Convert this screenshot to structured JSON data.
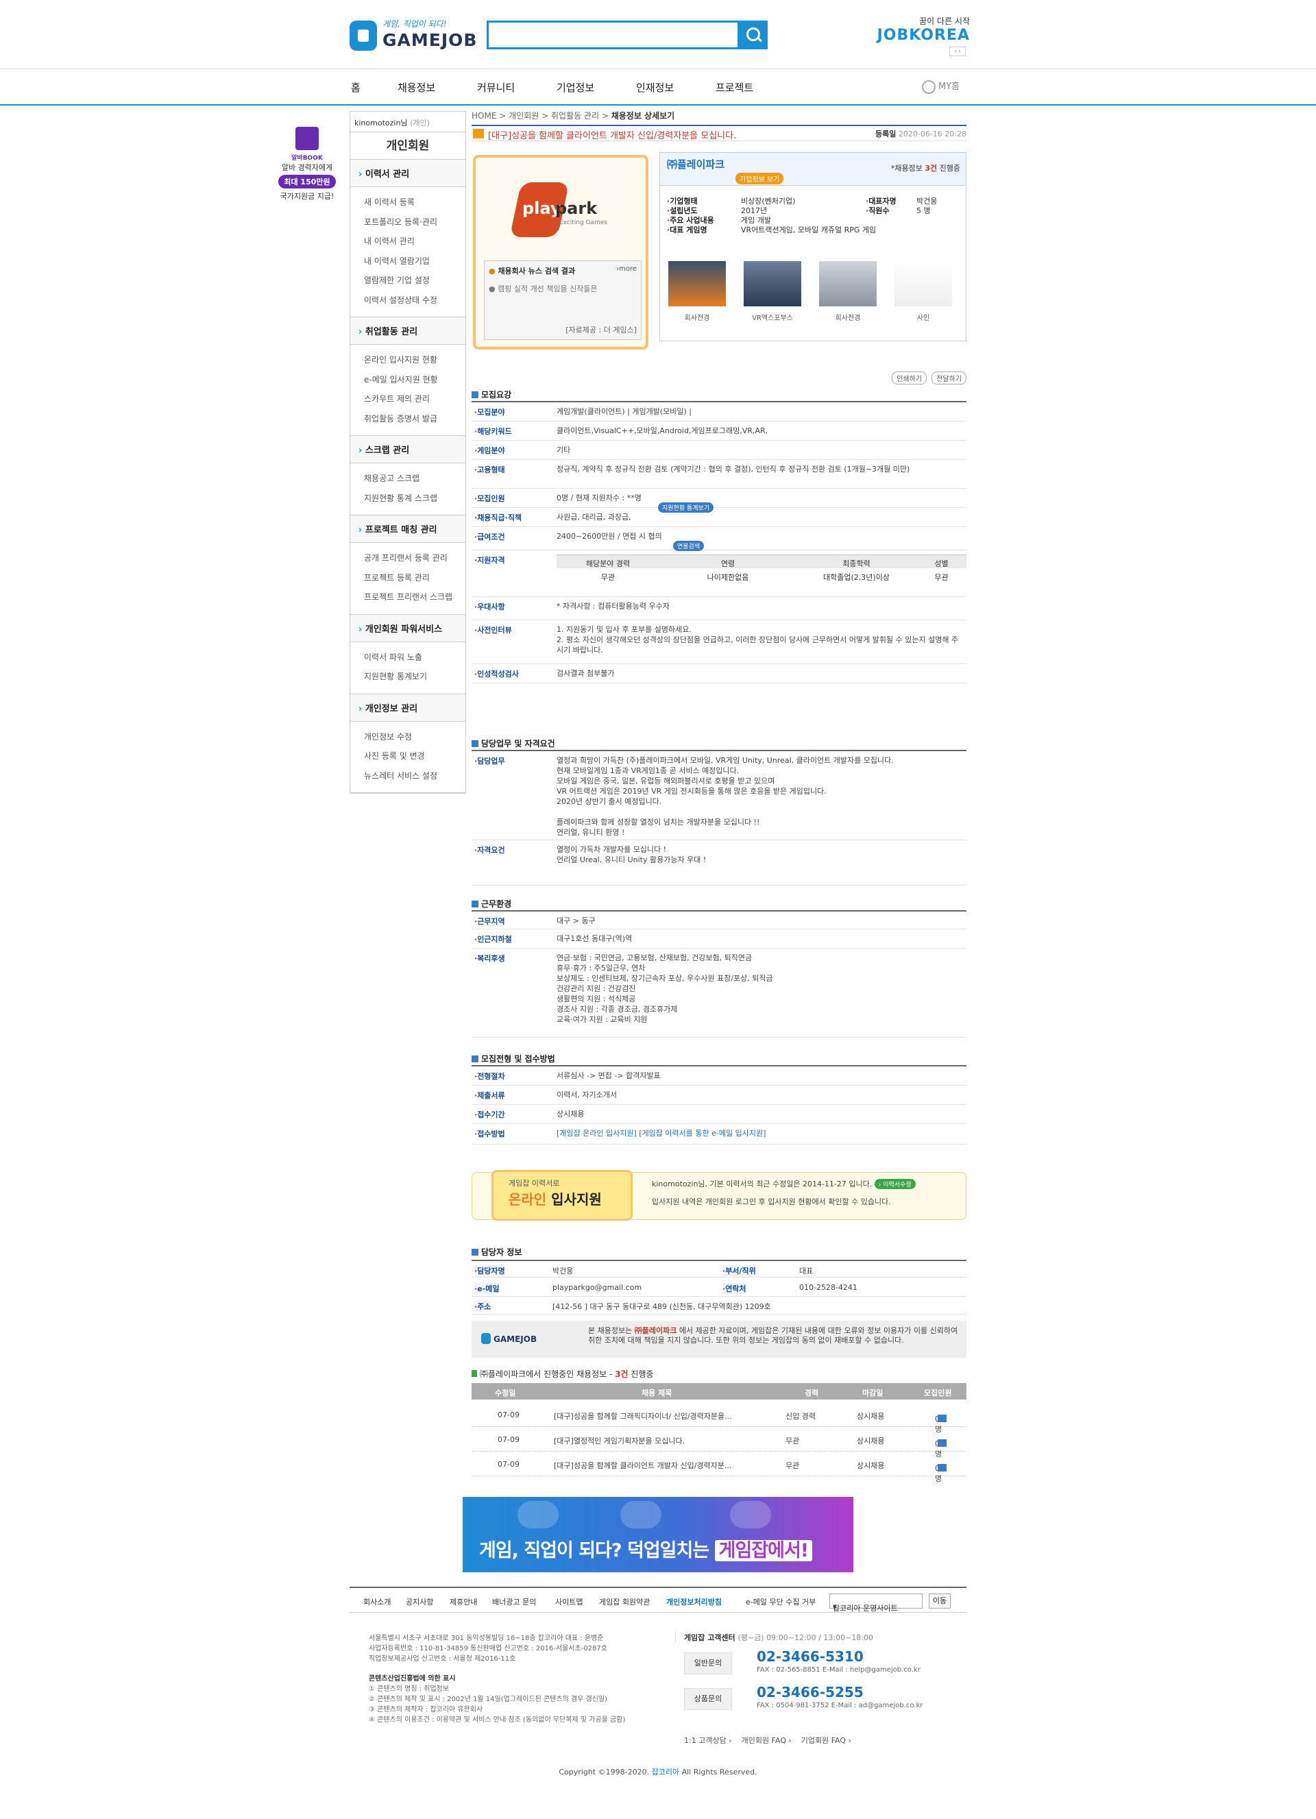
{
  "header": {
    "logo_tag": "게임, 직업이 되다!",
    "logo_name": "GAMEJOB",
    "search_value": "",
    "jobkorea_small": "꿈이 다른 시작",
    "jobkorea_big": "JOBKOREA",
    "jk_arrows": "‹ ›"
  },
  "gnb": [
    "홈",
    "채용정보",
    "커뮤니티",
    "기업정보",
    "인재정보",
    "프로젝트"
  ],
  "myhome": "MY홈",
  "sidebanner": {
    "brand": "알바BOOK",
    "l1": "알바 경력자에게",
    "pill": "최대 150만원",
    "l2": "국가지원금 지급!"
  },
  "lnb": {
    "user": "kinomotozin님",
    "user_type": "(개인)",
    "title": "개인회원",
    "sections": [
      {
        "name": "이력서 관리",
        "items": [
          "새 이력서 등록",
          "포트폴리오 등록·관리",
          "내 이력서 관리",
          "내 이력서 열람기업",
          "열람제한 기업 설정",
          "이력서 설정상태 수정"
        ]
      },
      {
        "name": "취업활동 관리",
        "items": [
          "온라인 입사지원 현황",
          "e-메일 입사지원 현황",
          "스카우트 제의 관리",
          "취업활동 증명서 발급"
        ]
      },
      {
        "name": "스크랩 관리",
        "items": [
          "채용공고 스크랩",
          "지원현황 통계 스크랩"
        ]
      },
      {
        "name": "프로젝트 매칭 관리",
        "items": [
          "공개 프리랜서 등록 관리",
          "프로젝트 등록 관리",
          "프로젝트 프리랜서 스크랩"
        ]
      },
      {
        "name": "개인회원 파워서비스",
        "items": [
          "이력서 파워 노출",
          "지원현황 통계보기"
        ]
      },
      {
        "name": "개인정보 관리",
        "items": [
          "개인정보 수정",
          "사진 등록 및 변경",
          "뉴스레터 서비스 설정"
        ]
      }
    ]
  },
  "breadcrumb": {
    "a": "HOME",
    "b": "개인회원",
    "c": "취업활동 관리",
    "d": "채용정보 상세보기"
  },
  "job": {
    "title": "[대구]성공을 함께할 클라이언트 개발자 신입/경력자분을 모십니다.",
    "reg_label": "등록일",
    "reg_date": "2020-06-16 20:28"
  },
  "company": {
    "card_logo1": "play",
    "card_logo2": "park",
    "card_logo3": "Exciting Games",
    "news_head": "채용회사 뉴스 검색 결과",
    "news_more": "›more",
    "news_item": "● 캠핑 실적 개선 책임을 신작들은",
    "news_src": "[자료제공 : 더 게임스]",
    "name": "㈜플레이파크",
    "info_btn": "기업정보 보기",
    "count_pre": "*채용정보",
    "count_num": "3건",
    "count_post": "진행중",
    "rows": [
      [
        "기업형태",
        "비상장(벤처기업)"
      ],
      [
        "설립년도",
        "2017년"
      ],
      [
        "주요 사업내용",
        "게임 개발"
      ],
      [
        "대표 게임명",
        "VR어트랙션게임, 모바일 캐쥬얼 RPG 게임"
      ]
    ],
    "rows2": [
      [
        "대표자명",
        "박건웅"
      ],
      [
        "직원수",
        "5 명"
      ]
    ],
    "thumbs": [
      "회사전경",
      "VR엑스포부스",
      "회사전경",
      "사인"
    ]
  },
  "print_btns": [
    "인쇄하기",
    "전달하기"
  ],
  "recruit": {
    "header": "모집요강",
    "rows": [
      {
        "k": "모집분야",
        "v": "게임개발(클라이언트) | 게임개발(모바일) |"
      },
      {
        "k": "해당키워드",
        "v": "클라이언트,VisualC++,모바일,Android,게임프로그래밍,VR,AR,"
      },
      {
        "k": "게임분야",
        "v": "기타"
      },
      {
        "k": "고용형태",
        "v": "정규직, 계약직 후 정규직 전환 검토 (계약기간 : 협의 후 결정), 인턴직 후 정규직 전환 검토 (1개월~3개월 미만)"
      },
      {
        "k": "모집인원",
        "v": "0명 / 현재 지원자수 : **명"
      },
      {
        "k": "채용직급·직책",
        "v": "사원급, 대리급, 과장급,"
      },
      {
        "k": "급여조건",
        "v": "2400~2600만원 / 면접 시 협의"
      },
      {
        "k": "지원자격",
        "v": ""
      },
      {
        "k": "우대사항",
        "v": "* 자격사항 : 컴퓨터활용능력 우수자"
      },
      {
        "k": "사전인터뷰",
        "v": "1. 지원동기 및 입사 후 포부를 설명하세요.\n2. 평소 자신이 생각해오던 성격상의 장단점을 언급하고, 이러한 장단점이 당사에 근무하면서 어떻게 발휘될 수 있는지 설명해 주시기 바랍니다."
      },
      {
        "k": "인성적성검사",
        "v": "검사결과 첨부불가"
      }
    ],
    "badge_stats": "지원현황 통계보기",
    "badge_salary": "연봉검색",
    "qual_head": [
      "해당분야 경력",
      "연령",
      "최종학력",
      "성별"
    ],
    "qual_row": [
      "무관",
      "나이제한없음",
      "대학졸업(2,3년)이상",
      "무관"
    ]
  },
  "duty": {
    "header": "담당업무 및 자격요건",
    "rows": [
      {
        "k": "담당업무",
        "v": "열정과 희망이 가득찬 (주)플레이파크에서 모바일, VR게임 Unity, Unreal, 클라이언트 개발자를 모집니다.\n현재 모바일게임 1종과 VR게임1종 곧 서비스 예정입니다.\n모바일 게임은 중국, 일본, 유럽등 해외퍼블리셔로 호평을 받고 있으며\nVR 어트랙션 게임은 2019년 VR 게임 전시회등을 통해 많은 호응을 받은 게임입니다.\n2020년 상반기 출시 예정입니다.\n\n플레이파크와 함께 성장할 열정이 넘치는 개발자분을 모십니다 !!\n연리얼, 유니티 환영 !"
      },
      {
        "k": "자격요건",
        "v": "열정이 가득차 개발자를 모십니다 !\n언리얼 Ureal, 유니티 Unity 활용가능자 우대 !"
      }
    ]
  },
  "work": {
    "header": "근무환경",
    "rows": [
      {
        "k": "근무지역",
        "v": "대구 > 동구"
      },
      {
        "k": "인근지하철",
        "v": "대구1호선 동대구(역)역"
      },
      {
        "k": "복리후생",
        "v": "연금·보험 : 국민연금, 고용보험, 산재보험, 건강보험, 퇴직연금\n휴무·휴가 : 주5일근무, 연차\n보상제도 : 인센티브제, 장기근속자 포상, 우수사원 표창/포상, 퇴직금\n건강관리 지원 : 건강검진\n생활편의 지원 : 석식제공\n경조사 지원 : 각종 경조금, 경조휴가제\n교육·여가 지원 : 교육비 지원"
      }
    ]
  },
  "process": {
    "header": "모집전형 및 접수방법",
    "rows": [
      {
        "k": "전형절차",
        "v": "서류심사 -> 면접 -> 합격자발표"
      },
      {
        "k": "제출서류",
        "v": "이력서, 자기소개서"
      },
      {
        "k": "접수기간",
        "v": "상시채용"
      },
      {
        "k": "접수방법",
        "v": "[게임잡 온라인 입사지원]  [게임잡 이력서를 통한 e-메일 입사지원]"
      }
    ]
  },
  "apply": {
    "small": "게임잡 이력서로",
    "big1": "온라인",
    "big2": "입사지원",
    "l1": "kinomotozin님, 기본 이력서의 최근 수정일은 2014-11-27 입니다.",
    "l1_badge": "› 이력서수정",
    "l2": "입사지원 내역은 개인회원 로그인 후 입사지원 현황에서 확인할 수 있습니다."
  },
  "contact": {
    "header": "담당자 정보",
    "name_k": "담당자명",
    "name_v": "박건웅",
    "dept_k": "부서/직위",
    "dept_v": "대표",
    "email_k": "e-메일",
    "email_v": "playparkgo@gmail.com",
    "tel_k": "연락처",
    "tel_v": "010-2528-4241",
    "addr_k": "주소",
    "addr_v": "[412-56 ] 대구 동구 동대구로 489 (신천동, 대구무역회관) 1209호"
  },
  "notice": {
    "logo": "GAMEJOB",
    "pre": "본 채용정보는",
    "co": "㈜플레이파크",
    "post": "에서 제공한 자료이며, 게임잡은 기재된 내용에 대한 오류와 정보 이용자가 이를 신뢰하여 취한 조치에 대해 책임을 지지 않습니다. 또한 위의 정보는 게임잡의 동의 없이 재배포할 수 없습니다."
  },
  "others": {
    "pre": "㈜플레이파크에서 진행중인 채용정보 - ",
    "num": "3건",
    "post": " 진행중",
    "head": [
      "수정일",
      "채용 제목",
      "경력",
      "마감일",
      "모집인원"
    ],
    "rows": [
      [
        "07-09",
        "[대구]성공을 함께할 그래픽디자이너/ 신입/경력자분을...",
        "신입 경력",
        "상시채용",
        "0명"
      ],
      [
        "07-09",
        "[대구]열정적인 게임기획자분을 모십니다.",
        "무관",
        "상시채용",
        "0명"
      ],
      [
        "07-09",
        "[대구]성공을 함께할 클라이언트 개발자 신입/경력자분...",
        "무관",
        "상시채용",
        "0명"
      ]
    ]
  },
  "banner": {
    "text1": "게임, 직업이 되다? 덕업일치는",
    "text2": "게임잡에서!"
  },
  "footer": {
    "links": [
      "회사소개",
      "공지사항",
      "제휴안내",
      "배너광고 문의",
      "사이트맵",
      "게임잡 회원약관",
      "개인정보처리방침",
      "e-메일 무단 수집 거부"
    ],
    "select": "잡코리아 운영사이트",
    "go": "이동",
    "addr": [
      "서울특별시 서초구 서초대로 301 동익성봉빌딩 16~18층 잡코리아  대표 : 윤병준",
      "사업자등록번호 : 110-81-34859  통신판매업 신고번호 : 2016-서울서초-0287호",
      "직업정보제공사업 신고번호 : 서울청 제2016-11호"
    ],
    "content_h": "콘텐츠산업진흥법에 의한 표시",
    "content": [
      "① 콘텐츠의 명칭 : 취업정보",
      "② 콘텐츠의 제작 및 표시 : 2002년 1월 14일(업그레이드된 콘텐츠의 경우 갱신일)",
      "③ 콘텐츠의 제작자 : 잡코리아 유한회사",
      "④ 콘텐츠의 이용조건 : 이용약관 및 서비스 안내 참조 (동의없이 무단복제 및 가공을 금함)"
    ],
    "cs_h": "게임잡 고객센터",
    "cs_hours": "(평~금) 09:00~12:00 / 13:00~18:00",
    "cs": [
      {
        "label": "일반문의",
        "tel": "02-3466-5310",
        "fax": "FAX : 02-565-8851   E-Mail : help@gamejob.co.kr"
      },
      {
        "label": "상품문의",
        "tel": "02-3466-5255",
        "fax": "FAX : 0504-981-3752   E-Mail : ad@gamejob.co.kr"
      }
    ],
    "faq": [
      "1:1 고객상담 ›",
      "개인회원 FAQ ›",
      "기업회원 FAQ ›"
    ],
    "copy_pre": "Copyright ©1998-2020.",
    "copy_co": "잡코리아",
    "copy_post": "All Rights Reserved."
  },
  "colors": {
    "accent": "#1a8fd1",
    "navy": "#23375a",
    "highlight": "#c0392b",
    "gold": "#f5c36a"
  }
}
